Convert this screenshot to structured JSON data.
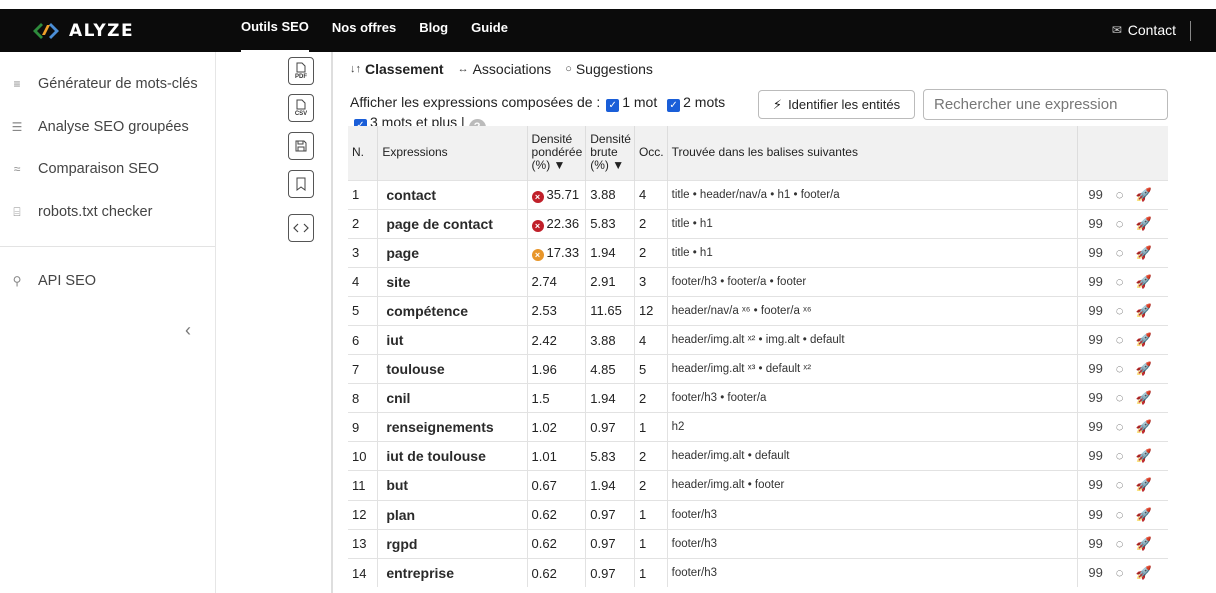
{
  "brand": {
    "name": "ALYZE"
  },
  "nav": {
    "items": [
      "Outils SEO",
      "Nos offres",
      "Blog",
      "Guide"
    ],
    "active": "Outils SEO",
    "contact": "Contact"
  },
  "sidebar": {
    "items": [
      {
        "label": "Générateur de mots-clés",
        "icon": "list-icon"
      },
      {
        "label": "Analyse SEO groupées",
        "icon": "numbered-list-icon"
      },
      {
        "label": "Comparaison SEO",
        "icon": "approx-icon"
      },
      {
        "label": "robots.txt checker",
        "icon": "robot-icon"
      },
      {
        "label": "API SEO",
        "icon": "plug-icon"
      }
    ]
  },
  "tools": {
    "pdf_label": "PDF",
    "csv_label": "CSV"
  },
  "tabs": [
    {
      "label": "Classement",
      "glyph": "↓↑"
    },
    {
      "label": "Associations",
      "glyph": "↔"
    },
    {
      "label": "Suggestions",
      "glyph": "💡"
    }
  ],
  "filters": {
    "prefix": "Afficher les expressions composées de :",
    "opt1": "1 mot",
    "opt2": "2 mots",
    "opt3": "3 mots et plus",
    "help": "?",
    "pipe": "|"
  },
  "entities_button": "Identifier les entités",
  "search": {
    "placeholder": "Rechercher une expression"
  },
  "table": {
    "headers": {
      "n": "N.",
      "expr": "Expressions",
      "dens_pond": [
        "Densité",
        "pondérée",
        "(%) ▼"
      ],
      "dens_brute": [
        "Densité",
        "brute",
        "(%) ▼"
      ],
      "occ": "Occ.",
      "tags": "Trouvée dans les balises suivantes"
    },
    "rows": [
      {
        "n": "1",
        "expr": "contact",
        "badge": "red",
        "dp": "35.71",
        "db": "3.88",
        "occ": "4",
        "tags": "title • header/nav/a • h1 • footer/a"
      },
      {
        "n": "2",
        "expr": "page de contact",
        "badge": "red",
        "dp": "22.36",
        "db": "5.83",
        "occ": "2",
        "tags": "title • h1"
      },
      {
        "n": "3",
        "expr": "page",
        "badge": "orange",
        "dp": "17.33",
        "db": "1.94",
        "occ": "2",
        "tags": "title • h1"
      },
      {
        "n": "4",
        "expr": "site",
        "badge": "",
        "dp": "2.74",
        "db": "2.91",
        "occ": "3",
        "tags": "footer/h3 • footer/a • footer"
      },
      {
        "n": "5",
        "expr": "compétence",
        "badge": "",
        "dp": "2.53",
        "db": "11.65",
        "occ": "12",
        "tags": "header/nav/a ˣ⁶ • footer/a ˣ⁶"
      },
      {
        "n": "6",
        "expr": "iut",
        "badge": "",
        "dp": "2.42",
        "db": "3.88",
        "occ": "4",
        "tags": "header/img.alt ˣ² • img.alt • default"
      },
      {
        "n": "7",
        "expr": "toulouse",
        "badge": "",
        "dp": "1.96",
        "db": "4.85",
        "occ": "5",
        "tags": "header/img.alt ˣ³ • default ˣ²"
      },
      {
        "n": "8",
        "expr": "cnil",
        "badge": "",
        "dp": "1.5",
        "db": "1.94",
        "occ": "2",
        "tags": "footer/h3 • footer/a"
      },
      {
        "n": "9",
        "expr": "renseignements",
        "badge": "",
        "dp": "1.02",
        "db": "0.97",
        "occ": "1",
        "tags": "h2"
      },
      {
        "n": "10",
        "expr": "iut de toulouse",
        "badge": "",
        "dp": "1.01",
        "db": "5.83",
        "occ": "2",
        "tags": "header/img.alt • default"
      },
      {
        "n": "11",
        "expr": "but",
        "badge": "",
        "dp": "0.67",
        "db": "1.94",
        "occ": "2",
        "tags": "header/img.alt • footer"
      },
      {
        "n": "12",
        "expr": "plan",
        "badge": "",
        "dp": "0.62",
        "db": "0.97",
        "occ": "1",
        "tags": "footer/h3"
      },
      {
        "n": "13",
        "expr": "rgpd",
        "badge": "",
        "dp": "0.62",
        "db": "0.97",
        "occ": "1",
        "tags": "footer/h3"
      },
      {
        "n": "14",
        "expr": "entreprise",
        "badge": "",
        "dp": "0.62",
        "db": "0.97",
        "occ": "1",
        "tags": "footer/h3"
      }
    ],
    "row_actions": [
      "quote-icon",
      "bulb-icon",
      "rocket-icon"
    ]
  },
  "colors": {
    "checkbox": "#1a5ed8",
    "badge_red": "#c0202a",
    "badge_orange": "#e8962a",
    "topbar": "#0b0b0b"
  }
}
